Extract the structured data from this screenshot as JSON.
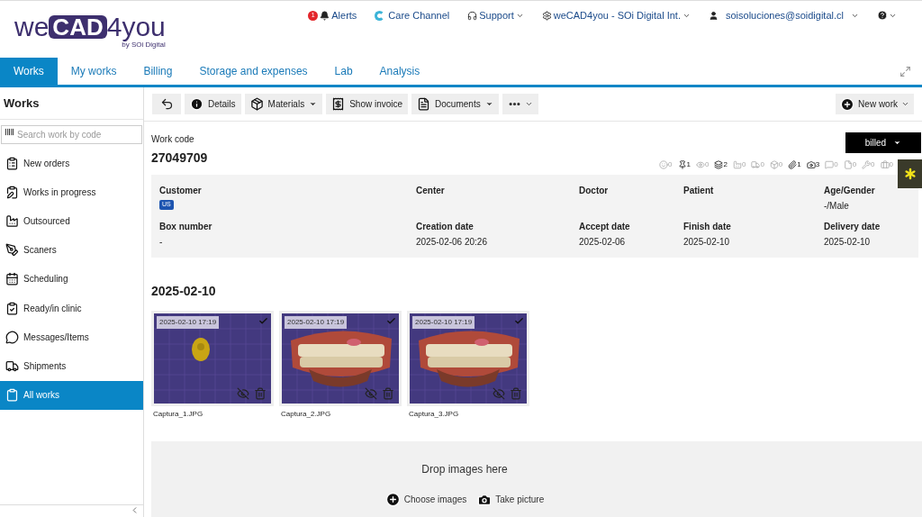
{
  "logo": {
    "part1": "we",
    "part2": "CAD",
    "part3": "4you",
    "tagline": "by SOi Digital"
  },
  "top_nav": {
    "alerts": {
      "badge": "1",
      "label": "Alerts"
    },
    "care": "Care Channel",
    "support": "Support",
    "company": "weCAD4you - SOi Digital Int.",
    "user": "soisoluciones@soidigital.cl"
  },
  "tabs": [
    {
      "label": "Works",
      "selected": true
    },
    {
      "label": "My works",
      "selected": false
    },
    {
      "label": "Billing",
      "selected": false
    },
    {
      "label": "Storage and expenses",
      "selected": false
    },
    {
      "label": "Lab",
      "selected": false
    },
    {
      "label": "Analysis",
      "selected": false
    }
  ],
  "sidebar": {
    "title": "Works",
    "search": {
      "placeholder": "Search work by code"
    },
    "items": [
      {
        "label": "New orders",
        "selected": false
      },
      {
        "label": "Works in progress",
        "selected": false
      },
      {
        "label": "Outsourced",
        "selected": false
      },
      {
        "label": "Scaners",
        "selected": false
      },
      {
        "label": "Scheduling",
        "selected": false
      },
      {
        "label": "Ready/in clinic",
        "selected": false
      },
      {
        "label": "Messages/Items",
        "selected": false
      },
      {
        "label": "Shipments",
        "selected": false
      },
      {
        "label": "All works",
        "selected": true
      }
    ]
  },
  "toolbar": {
    "buttons": [
      {
        "label": "Details",
        "caret": false
      },
      {
        "label": "Materials",
        "caret": true
      },
      {
        "label": "Show invoice",
        "caret": false
      },
      {
        "label": "Documents",
        "caret": true
      }
    ],
    "new_work": "New work"
  },
  "work": {
    "code_label": "Work code",
    "code": "27049709",
    "status": "billed",
    "counters": [
      {
        "count": "0"
      },
      {
        "count": "1"
      },
      {
        "count": "0"
      },
      {
        "count": "2"
      },
      {
        "count": "0"
      },
      {
        "count": "0"
      },
      {
        "count": "0"
      },
      {
        "count": "1"
      },
      {
        "count": "3"
      },
      {
        "count": "0"
      },
      {
        "count": "0"
      },
      {
        "count": "0"
      },
      {
        "count": "0"
      }
    ],
    "fields": [
      {
        "label": "Customer",
        "badge": "US"
      },
      {
        "label": "Center"
      },
      {
        "label": "Doctor"
      },
      {
        "label": "Patient"
      },
      {
        "label": "Age/Gender",
        "value": "-/Male"
      },
      {
        "label": "Box number",
        "value": "-"
      },
      {
        "label": "Creation date",
        "value": "2025-02-06 20:26"
      },
      {
        "label": "Accept date",
        "value": "2025-02-06"
      },
      {
        "label": "Finish date",
        "value": "2025-02-10"
      },
      {
        "label": "Delivery date",
        "value": "2025-02-10"
      }
    ]
  },
  "gallery": {
    "date": "2025-02-10",
    "images": [
      {
        "timestamp": "2025-02-10 17:19",
        "caption": "Captura_1.JPG",
        "checked": true,
        "kind": "part"
      },
      {
        "timestamp": "2025-02-10 17:19",
        "caption": "Captura_2.JPG",
        "checked": true,
        "kind": "teeth"
      },
      {
        "timestamp": "2025-02-10 17:19",
        "caption": "Captura_3.JPG",
        "checked": true,
        "kind": "teeth"
      }
    ]
  },
  "dropzone": {
    "title": "Drop images here",
    "choose": "Choose images",
    "take": "Take picture"
  }
}
